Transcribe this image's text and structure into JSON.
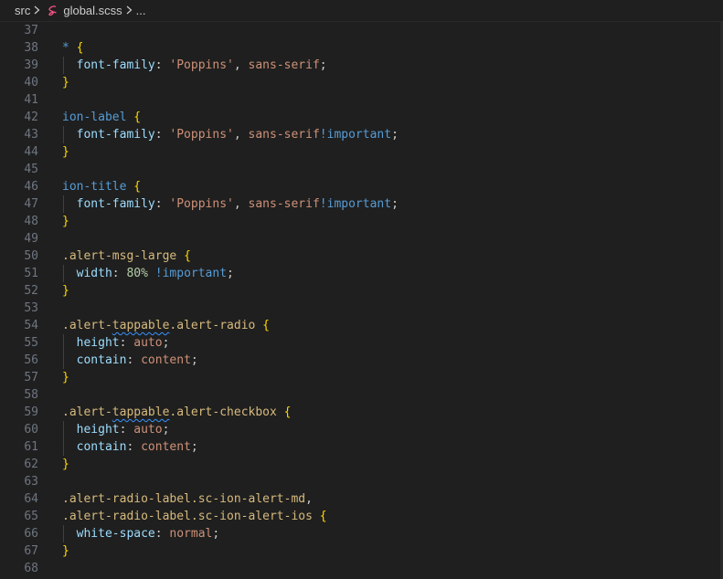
{
  "breadcrumb": {
    "folder": "src",
    "file": "global.scss",
    "more": "..."
  },
  "colors": {
    "background": "#1f1f1f",
    "line_number": "#6e7681",
    "selector": "#d7ba7d",
    "keyword": "#569cd6",
    "property": "#9cdcfe",
    "string": "#ce9178",
    "number": "#b5cea8",
    "bracket": "#ffd700",
    "sass_icon": "#f55385"
  },
  "editor": {
    "lines": [
      {
        "n": "37",
        "indent": false,
        "tokens": []
      },
      {
        "n": "38",
        "indent": false,
        "tokens": [
          {
            "t": "*",
            "c": "tag"
          },
          {
            "t": " "
          },
          {
            "t": "{",
            "c": "brace"
          }
        ]
      },
      {
        "n": "39",
        "indent": true,
        "tokens": [
          {
            "t": "font-family",
            "c": "prop"
          },
          {
            "t": ": "
          },
          {
            "t": "'Poppins'",
            "c": "str"
          },
          {
            "t": ", "
          },
          {
            "t": "sans-serif",
            "c": "val"
          },
          {
            "t": ";"
          }
        ]
      },
      {
        "n": "40",
        "indent": false,
        "tokens": [
          {
            "t": "}",
            "c": "brace"
          }
        ]
      },
      {
        "n": "41",
        "indent": false,
        "tokens": []
      },
      {
        "n": "42",
        "indent": false,
        "tokens": [
          {
            "t": "ion-label",
            "c": "tag"
          },
          {
            "t": " "
          },
          {
            "t": "{",
            "c": "brace"
          }
        ]
      },
      {
        "n": "43",
        "indent": true,
        "tokens": [
          {
            "t": "font-family",
            "c": "prop"
          },
          {
            "t": ": "
          },
          {
            "t": "'Poppins'",
            "c": "str"
          },
          {
            "t": ", "
          },
          {
            "t": "sans-serif",
            "c": "val"
          },
          {
            "t": "!important",
            "c": "imp"
          },
          {
            "t": ";"
          }
        ]
      },
      {
        "n": "44",
        "indent": false,
        "tokens": [
          {
            "t": "}",
            "c": "brace"
          }
        ]
      },
      {
        "n": "45",
        "indent": false,
        "tokens": []
      },
      {
        "n": "46",
        "indent": false,
        "tokens": [
          {
            "t": "ion-title",
            "c": "tag"
          },
          {
            "t": " "
          },
          {
            "t": "{",
            "c": "brace"
          }
        ]
      },
      {
        "n": "47",
        "indent": true,
        "tokens": [
          {
            "t": "font-family",
            "c": "prop"
          },
          {
            "t": ": "
          },
          {
            "t": "'Poppins'",
            "c": "str"
          },
          {
            "t": ", "
          },
          {
            "t": "sans-serif",
            "c": "val"
          },
          {
            "t": "!important",
            "c": "imp"
          },
          {
            "t": ";"
          }
        ]
      },
      {
        "n": "48",
        "indent": false,
        "tokens": [
          {
            "t": "}",
            "c": "brace"
          }
        ]
      },
      {
        "n": "49",
        "indent": false,
        "tokens": []
      },
      {
        "n": "50",
        "indent": false,
        "tokens": [
          {
            "t": ".alert-msg-large",
            "c": "sel"
          },
          {
            "t": " "
          },
          {
            "t": "{",
            "c": "brace"
          }
        ]
      },
      {
        "n": "51",
        "indent": true,
        "tokens": [
          {
            "t": "width",
            "c": "prop"
          },
          {
            "t": ": "
          },
          {
            "t": "80%",
            "c": "num"
          },
          {
            "t": " "
          },
          {
            "t": "!important",
            "c": "imp"
          },
          {
            "t": ";"
          }
        ]
      },
      {
        "n": "52",
        "indent": false,
        "tokens": [
          {
            "t": "}",
            "c": "brace"
          }
        ]
      },
      {
        "n": "53",
        "indent": false,
        "tokens": []
      },
      {
        "n": "54",
        "indent": false,
        "tokens": [
          {
            "t": ".alert-",
            "c": "sel"
          },
          {
            "t": "tappable",
            "c": "sel",
            "squig": true
          },
          {
            "t": ".alert-radio",
            "c": "sel"
          },
          {
            "t": " "
          },
          {
            "t": "{",
            "c": "brace"
          }
        ]
      },
      {
        "n": "55",
        "indent": true,
        "tokens": [
          {
            "t": "height",
            "c": "prop"
          },
          {
            "t": ": "
          },
          {
            "t": "auto",
            "c": "val"
          },
          {
            "t": ";"
          }
        ]
      },
      {
        "n": "56",
        "indent": true,
        "tokens": [
          {
            "t": "contain",
            "c": "prop"
          },
          {
            "t": ": "
          },
          {
            "t": "content",
            "c": "val"
          },
          {
            "t": ";"
          }
        ]
      },
      {
        "n": "57",
        "indent": false,
        "tokens": [
          {
            "t": "}",
            "c": "brace"
          }
        ]
      },
      {
        "n": "58",
        "indent": false,
        "tokens": []
      },
      {
        "n": "59",
        "indent": false,
        "tokens": [
          {
            "t": ".alert-",
            "c": "sel"
          },
          {
            "t": "tappable",
            "c": "sel",
            "squig": true
          },
          {
            "t": ".alert-checkbox",
            "c": "sel"
          },
          {
            "t": " "
          },
          {
            "t": "{",
            "c": "brace"
          }
        ]
      },
      {
        "n": "60",
        "indent": true,
        "tokens": [
          {
            "t": "height",
            "c": "prop"
          },
          {
            "t": ": "
          },
          {
            "t": "auto",
            "c": "val"
          },
          {
            "t": ";"
          }
        ]
      },
      {
        "n": "61",
        "indent": true,
        "tokens": [
          {
            "t": "contain",
            "c": "prop"
          },
          {
            "t": ": "
          },
          {
            "t": "content",
            "c": "val"
          },
          {
            "t": ";"
          }
        ]
      },
      {
        "n": "62",
        "indent": false,
        "tokens": [
          {
            "t": "}",
            "c": "brace"
          }
        ]
      },
      {
        "n": "63",
        "indent": false,
        "tokens": []
      },
      {
        "n": "64",
        "indent": false,
        "tokens": [
          {
            "t": ".alert-radio-label.sc-ion-alert-md",
            "c": "sel"
          },
          {
            "t": ","
          }
        ]
      },
      {
        "n": "65",
        "indent": false,
        "tokens": [
          {
            "t": ".alert-radio-label.sc-ion-alert-ios",
            "c": "sel"
          },
          {
            "t": " "
          },
          {
            "t": "{",
            "c": "brace"
          }
        ]
      },
      {
        "n": "66",
        "indent": true,
        "tokens": [
          {
            "t": "white-space",
            "c": "prop"
          },
          {
            "t": ": "
          },
          {
            "t": "normal",
            "c": "val"
          },
          {
            "t": ";"
          }
        ]
      },
      {
        "n": "67",
        "indent": false,
        "tokens": [
          {
            "t": "}",
            "c": "brace"
          }
        ]
      },
      {
        "n": "68",
        "indent": false,
        "tokens": []
      }
    ]
  }
}
